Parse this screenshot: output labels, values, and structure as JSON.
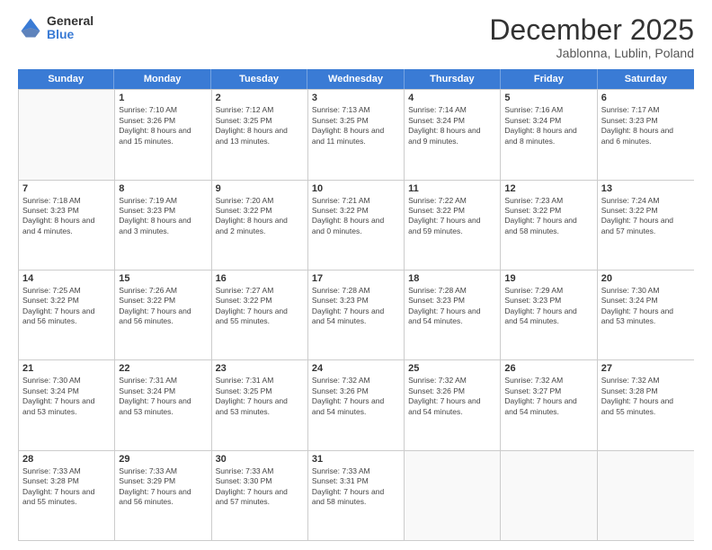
{
  "logo": {
    "general": "General",
    "blue": "Blue"
  },
  "title": "December 2025",
  "location": "Jablonna, Lublin, Poland",
  "header_days": [
    "Sunday",
    "Monday",
    "Tuesday",
    "Wednesday",
    "Thursday",
    "Friday",
    "Saturday"
  ],
  "weeks": [
    [
      {
        "day": "",
        "sunrise": "",
        "sunset": "",
        "daylight": ""
      },
      {
        "day": "1",
        "sunrise": "Sunrise: 7:10 AM",
        "sunset": "Sunset: 3:26 PM",
        "daylight": "Daylight: 8 hours and 15 minutes."
      },
      {
        "day": "2",
        "sunrise": "Sunrise: 7:12 AM",
        "sunset": "Sunset: 3:25 PM",
        "daylight": "Daylight: 8 hours and 13 minutes."
      },
      {
        "day": "3",
        "sunrise": "Sunrise: 7:13 AM",
        "sunset": "Sunset: 3:25 PM",
        "daylight": "Daylight: 8 hours and 11 minutes."
      },
      {
        "day": "4",
        "sunrise": "Sunrise: 7:14 AM",
        "sunset": "Sunset: 3:24 PM",
        "daylight": "Daylight: 8 hours and 9 minutes."
      },
      {
        "day": "5",
        "sunrise": "Sunrise: 7:16 AM",
        "sunset": "Sunset: 3:24 PM",
        "daylight": "Daylight: 8 hours and 8 minutes."
      },
      {
        "day": "6",
        "sunrise": "Sunrise: 7:17 AM",
        "sunset": "Sunset: 3:23 PM",
        "daylight": "Daylight: 8 hours and 6 minutes."
      }
    ],
    [
      {
        "day": "7",
        "sunrise": "Sunrise: 7:18 AM",
        "sunset": "Sunset: 3:23 PM",
        "daylight": "Daylight: 8 hours and 4 minutes."
      },
      {
        "day": "8",
        "sunrise": "Sunrise: 7:19 AM",
        "sunset": "Sunset: 3:23 PM",
        "daylight": "Daylight: 8 hours and 3 minutes."
      },
      {
        "day": "9",
        "sunrise": "Sunrise: 7:20 AM",
        "sunset": "Sunset: 3:22 PM",
        "daylight": "Daylight: 8 hours and 2 minutes."
      },
      {
        "day": "10",
        "sunrise": "Sunrise: 7:21 AM",
        "sunset": "Sunset: 3:22 PM",
        "daylight": "Daylight: 8 hours and 0 minutes."
      },
      {
        "day": "11",
        "sunrise": "Sunrise: 7:22 AM",
        "sunset": "Sunset: 3:22 PM",
        "daylight": "Daylight: 7 hours and 59 minutes."
      },
      {
        "day": "12",
        "sunrise": "Sunrise: 7:23 AM",
        "sunset": "Sunset: 3:22 PM",
        "daylight": "Daylight: 7 hours and 58 minutes."
      },
      {
        "day": "13",
        "sunrise": "Sunrise: 7:24 AM",
        "sunset": "Sunset: 3:22 PM",
        "daylight": "Daylight: 7 hours and 57 minutes."
      }
    ],
    [
      {
        "day": "14",
        "sunrise": "Sunrise: 7:25 AM",
        "sunset": "Sunset: 3:22 PM",
        "daylight": "Daylight: 7 hours and 56 minutes."
      },
      {
        "day": "15",
        "sunrise": "Sunrise: 7:26 AM",
        "sunset": "Sunset: 3:22 PM",
        "daylight": "Daylight: 7 hours and 56 minutes."
      },
      {
        "day": "16",
        "sunrise": "Sunrise: 7:27 AM",
        "sunset": "Sunset: 3:22 PM",
        "daylight": "Daylight: 7 hours and 55 minutes."
      },
      {
        "day": "17",
        "sunrise": "Sunrise: 7:28 AM",
        "sunset": "Sunset: 3:23 PM",
        "daylight": "Daylight: 7 hours and 54 minutes."
      },
      {
        "day": "18",
        "sunrise": "Sunrise: 7:28 AM",
        "sunset": "Sunset: 3:23 PM",
        "daylight": "Daylight: 7 hours and 54 minutes."
      },
      {
        "day": "19",
        "sunrise": "Sunrise: 7:29 AM",
        "sunset": "Sunset: 3:23 PM",
        "daylight": "Daylight: 7 hours and 54 minutes."
      },
      {
        "day": "20",
        "sunrise": "Sunrise: 7:30 AM",
        "sunset": "Sunset: 3:24 PM",
        "daylight": "Daylight: 7 hours and 53 minutes."
      }
    ],
    [
      {
        "day": "21",
        "sunrise": "Sunrise: 7:30 AM",
        "sunset": "Sunset: 3:24 PM",
        "daylight": "Daylight: 7 hours and 53 minutes."
      },
      {
        "day": "22",
        "sunrise": "Sunrise: 7:31 AM",
        "sunset": "Sunset: 3:24 PM",
        "daylight": "Daylight: 7 hours and 53 minutes."
      },
      {
        "day": "23",
        "sunrise": "Sunrise: 7:31 AM",
        "sunset": "Sunset: 3:25 PM",
        "daylight": "Daylight: 7 hours and 53 minutes."
      },
      {
        "day": "24",
        "sunrise": "Sunrise: 7:32 AM",
        "sunset": "Sunset: 3:26 PM",
        "daylight": "Daylight: 7 hours and 54 minutes."
      },
      {
        "day": "25",
        "sunrise": "Sunrise: 7:32 AM",
        "sunset": "Sunset: 3:26 PM",
        "daylight": "Daylight: 7 hours and 54 minutes."
      },
      {
        "day": "26",
        "sunrise": "Sunrise: 7:32 AM",
        "sunset": "Sunset: 3:27 PM",
        "daylight": "Daylight: 7 hours and 54 minutes."
      },
      {
        "day": "27",
        "sunrise": "Sunrise: 7:32 AM",
        "sunset": "Sunset: 3:28 PM",
        "daylight": "Daylight: 7 hours and 55 minutes."
      }
    ],
    [
      {
        "day": "28",
        "sunrise": "Sunrise: 7:33 AM",
        "sunset": "Sunset: 3:28 PM",
        "daylight": "Daylight: 7 hours and 55 minutes."
      },
      {
        "day": "29",
        "sunrise": "Sunrise: 7:33 AM",
        "sunset": "Sunset: 3:29 PM",
        "daylight": "Daylight: 7 hours and 56 minutes."
      },
      {
        "day": "30",
        "sunrise": "Sunrise: 7:33 AM",
        "sunset": "Sunset: 3:30 PM",
        "daylight": "Daylight: 7 hours and 57 minutes."
      },
      {
        "day": "31",
        "sunrise": "Sunrise: 7:33 AM",
        "sunset": "Sunset: 3:31 PM",
        "daylight": "Daylight: 7 hours and 58 minutes."
      },
      {
        "day": "",
        "sunrise": "",
        "sunset": "",
        "daylight": ""
      },
      {
        "day": "",
        "sunrise": "",
        "sunset": "",
        "daylight": ""
      },
      {
        "day": "",
        "sunrise": "",
        "sunset": "",
        "daylight": ""
      }
    ]
  ]
}
